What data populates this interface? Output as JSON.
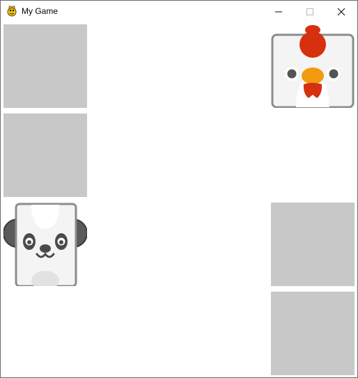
{
  "window": {
    "title": "My Game",
    "app_icon": "pygame-snake-icon",
    "buttons": {
      "minimize": "minimize-icon",
      "maximize": "maximize-icon",
      "close": "close-icon"
    }
  },
  "colors": {
    "tile_back": "#c8c8c8",
    "card_face": "#f4f4f4",
    "card_border": "#8c8c8c",
    "chicken_comb": "#d6310e",
    "chicken_beak": "#f39a10",
    "panda_dark": "#4a4a4a"
  },
  "board": {
    "cards": [
      {
        "state": "face-down"
      },
      {
        "state": "face-down"
      },
      {
        "state": "face-down"
      },
      {
        "state": "face-down"
      },
      {
        "state": "face-up",
        "animal": "chicken"
      },
      {
        "state": "face-up",
        "animal": "panda"
      }
    ]
  }
}
